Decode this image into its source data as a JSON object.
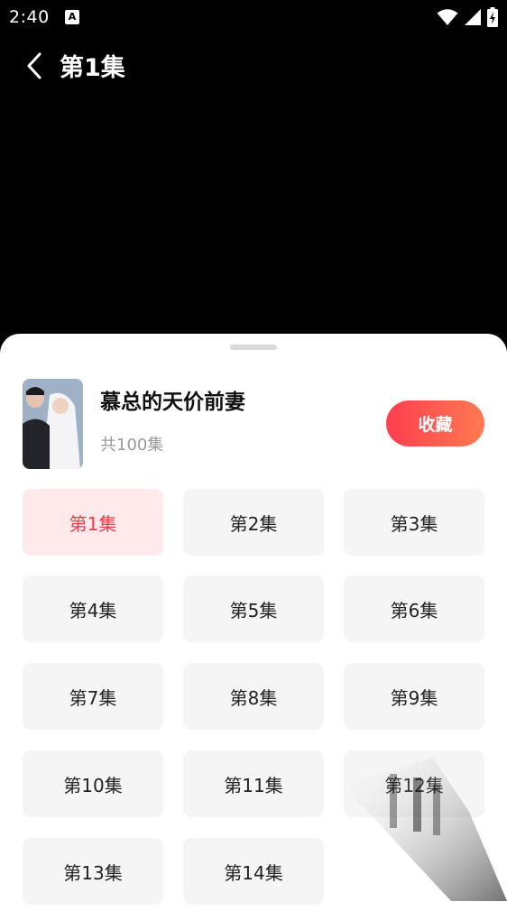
{
  "status": {
    "time": "2:40",
    "notif": "A"
  },
  "header": {
    "title": "第1集"
  },
  "drama": {
    "title": "慕总的天价前妻",
    "episode_count": "共100集",
    "favorite_label": "收藏"
  },
  "episodes": [
    {
      "label": "第1集",
      "active": true
    },
    {
      "label": "第2集"
    },
    {
      "label": "第3集"
    },
    {
      "label": "第4集"
    },
    {
      "label": "第5集"
    },
    {
      "label": "第6集"
    },
    {
      "label": "第7集"
    },
    {
      "label": "第8集"
    },
    {
      "label": "第9集"
    },
    {
      "label": "第10集"
    },
    {
      "label": "第11集"
    },
    {
      "label": "第12集"
    },
    {
      "label": "第13集"
    },
    {
      "label": "第14集"
    }
  ],
  "colors": {
    "accent": "#f2394a",
    "active_bg": "#ffe9ea",
    "item_bg": "#f5f5f5"
  }
}
